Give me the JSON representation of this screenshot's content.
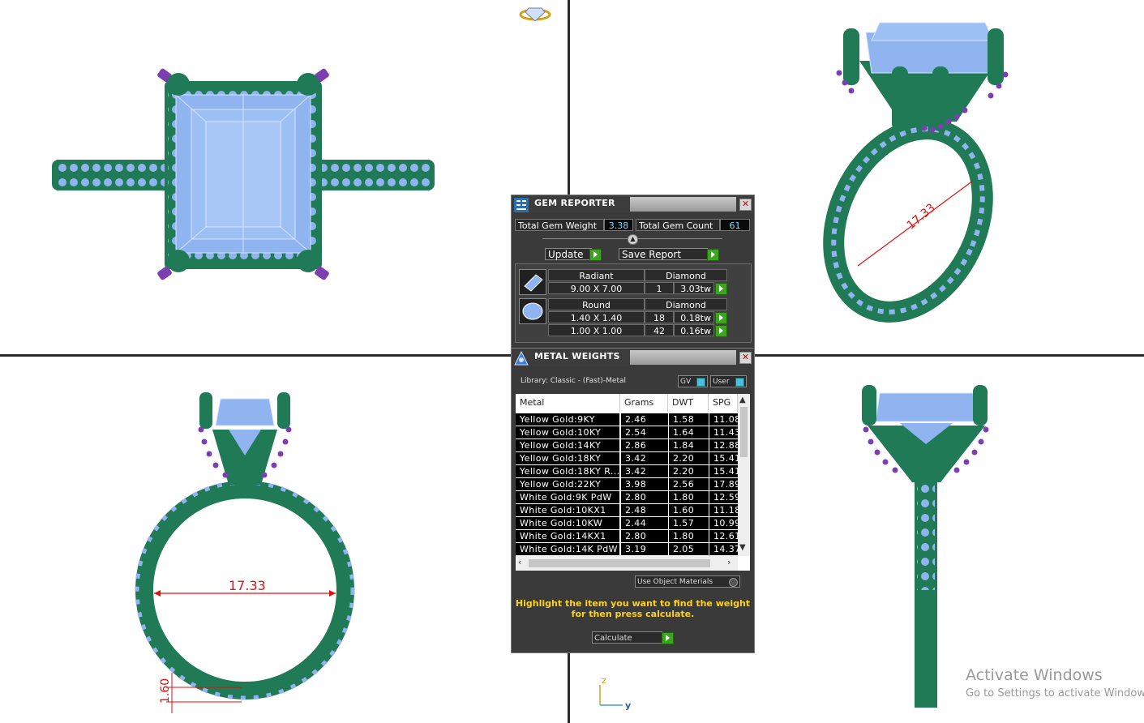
{
  "viewports": {
    "front_dimension_label": "17.33",
    "perspective_dimension_label": "17.33",
    "shank_thickness_label": "1.60",
    "axis_z": "z",
    "axis_y": "y"
  },
  "gem_reporter": {
    "title": "GEM REPORTER",
    "total_weight_label": "Total Gem Weight",
    "total_weight_value": "3.38",
    "total_count_label": "Total Gem Count",
    "total_count_value": "61",
    "update_label": "Update",
    "save_report_label": "Save Report",
    "gems": [
      {
        "shape": "Radiant",
        "material": "Diamond",
        "rows": [
          {
            "size": "9.00 X 7.00",
            "count": "1",
            "weight": "3.03tw"
          }
        ]
      },
      {
        "shape": "Round",
        "material": "Diamond",
        "rows": [
          {
            "size": "1.40 X 1.40",
            "count": "18",
            "weight": "0.18tw"
          },
          {
            "size": "1.00 X 1.00",
            "count": "42",
            "weight": "0.16tw"
          }
        ]
      }
    ]
  },
  "metal_weights": {
    "title": "METAL WEIGHTS",
    "library_label": "Library: Classic - (Fast)-Metal",
    "gv_label": "GV",
    "user_label": "User",
    "columns": [
      "Metal",
      "Grams",
      "DWT",
      "SPG"
    ],
    "rows": [
      [
        "Yellow Gold:9KY",
        "2.46",
        "1.58",
        "11.08"
      ],
      [
        "Yellow Gold:10KY",
        "2.54",
        "1.64",
        "11.43"
      ],
      [
        "Yellow Gold:14KY",
        "2.86",
        "1.84",
        "12.88"
      ],
      [
        "Yellow Gold:18KY",
        "3.42",
        "2.20",
        "15.41"
      ],
      [
        "Yellow Gold:18KY R...",
        "3.42",
        "2.20",
        "15.41"
      ],
      [
        "Yellow Gold:22KY",
        "3.98",
        "2.56",
        "17.89"
      ],
      [
        "White Gold:9K PdW",
        "2.80",
        "1.80",
        "12.59"
      ],
      [
        "White Gold:10KX1",
        "2.48",
        "1.60",
        "11.18"
      ],
      [
        "White Gold:10KW",
        "2.44",
        "1.57",
        "10.99"
      ],
      [
        "White Gold:14KX1",
        "2.80",
        "1.80",
        "12.61"
      ],
      [
        "White Gold:14K PdW",
        "3.19",
        "2.05",
        "14.37"
      ]
    ],
    "use_object_materials_label": "Use Object Materials",
    "hint_line1": "Highlight the item you want to find the weight",
    "hint_line2": "for then press calculate.",
    "calculate_label": "Calculate"
  },
  "watermark": {
    "line1": "Activate Windows",
    "line2": "Go to Settings to activate Windows."
  },
  "colors": {
    "metal": "#1f7a55",
    "gem": "#8fb4f0",
    "prong_tip": "#7b3fb0",
    "dimension": "#e01010"
  }
}
